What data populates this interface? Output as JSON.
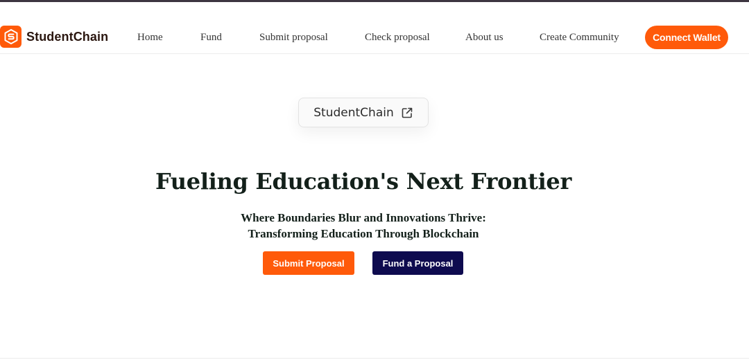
{
  "brand": {
    "name": "StudentChain",
    "logo_icon": "shield-s-logo-icon",
    "accent_color": "#ff5a0a",
    "dark_color": "#0e0b4f"
  },
  "nav": {
    "links": [
      "Home",
      "Fund",
      "Submit proposal",
      "Check proposal",
      "About us",
      "Create Community"
    ],
    "connect_label": "Connect Wallet"
  },
  "badge": {
    "label": "StudentChain",
    "icon": "external-link-icon"
  },
  "hero": {
    "title": "Fueling Education's Next Frontier",
    "subtitle_line1": "Where Boundaries Blur and Innovations Thrive:",
    "subtitle_line2": "Transforming Education Through Blockchain",
    "submit_label": "Submit Proposal",
    "fund_label": "Fund a Proposal"
  }
}
